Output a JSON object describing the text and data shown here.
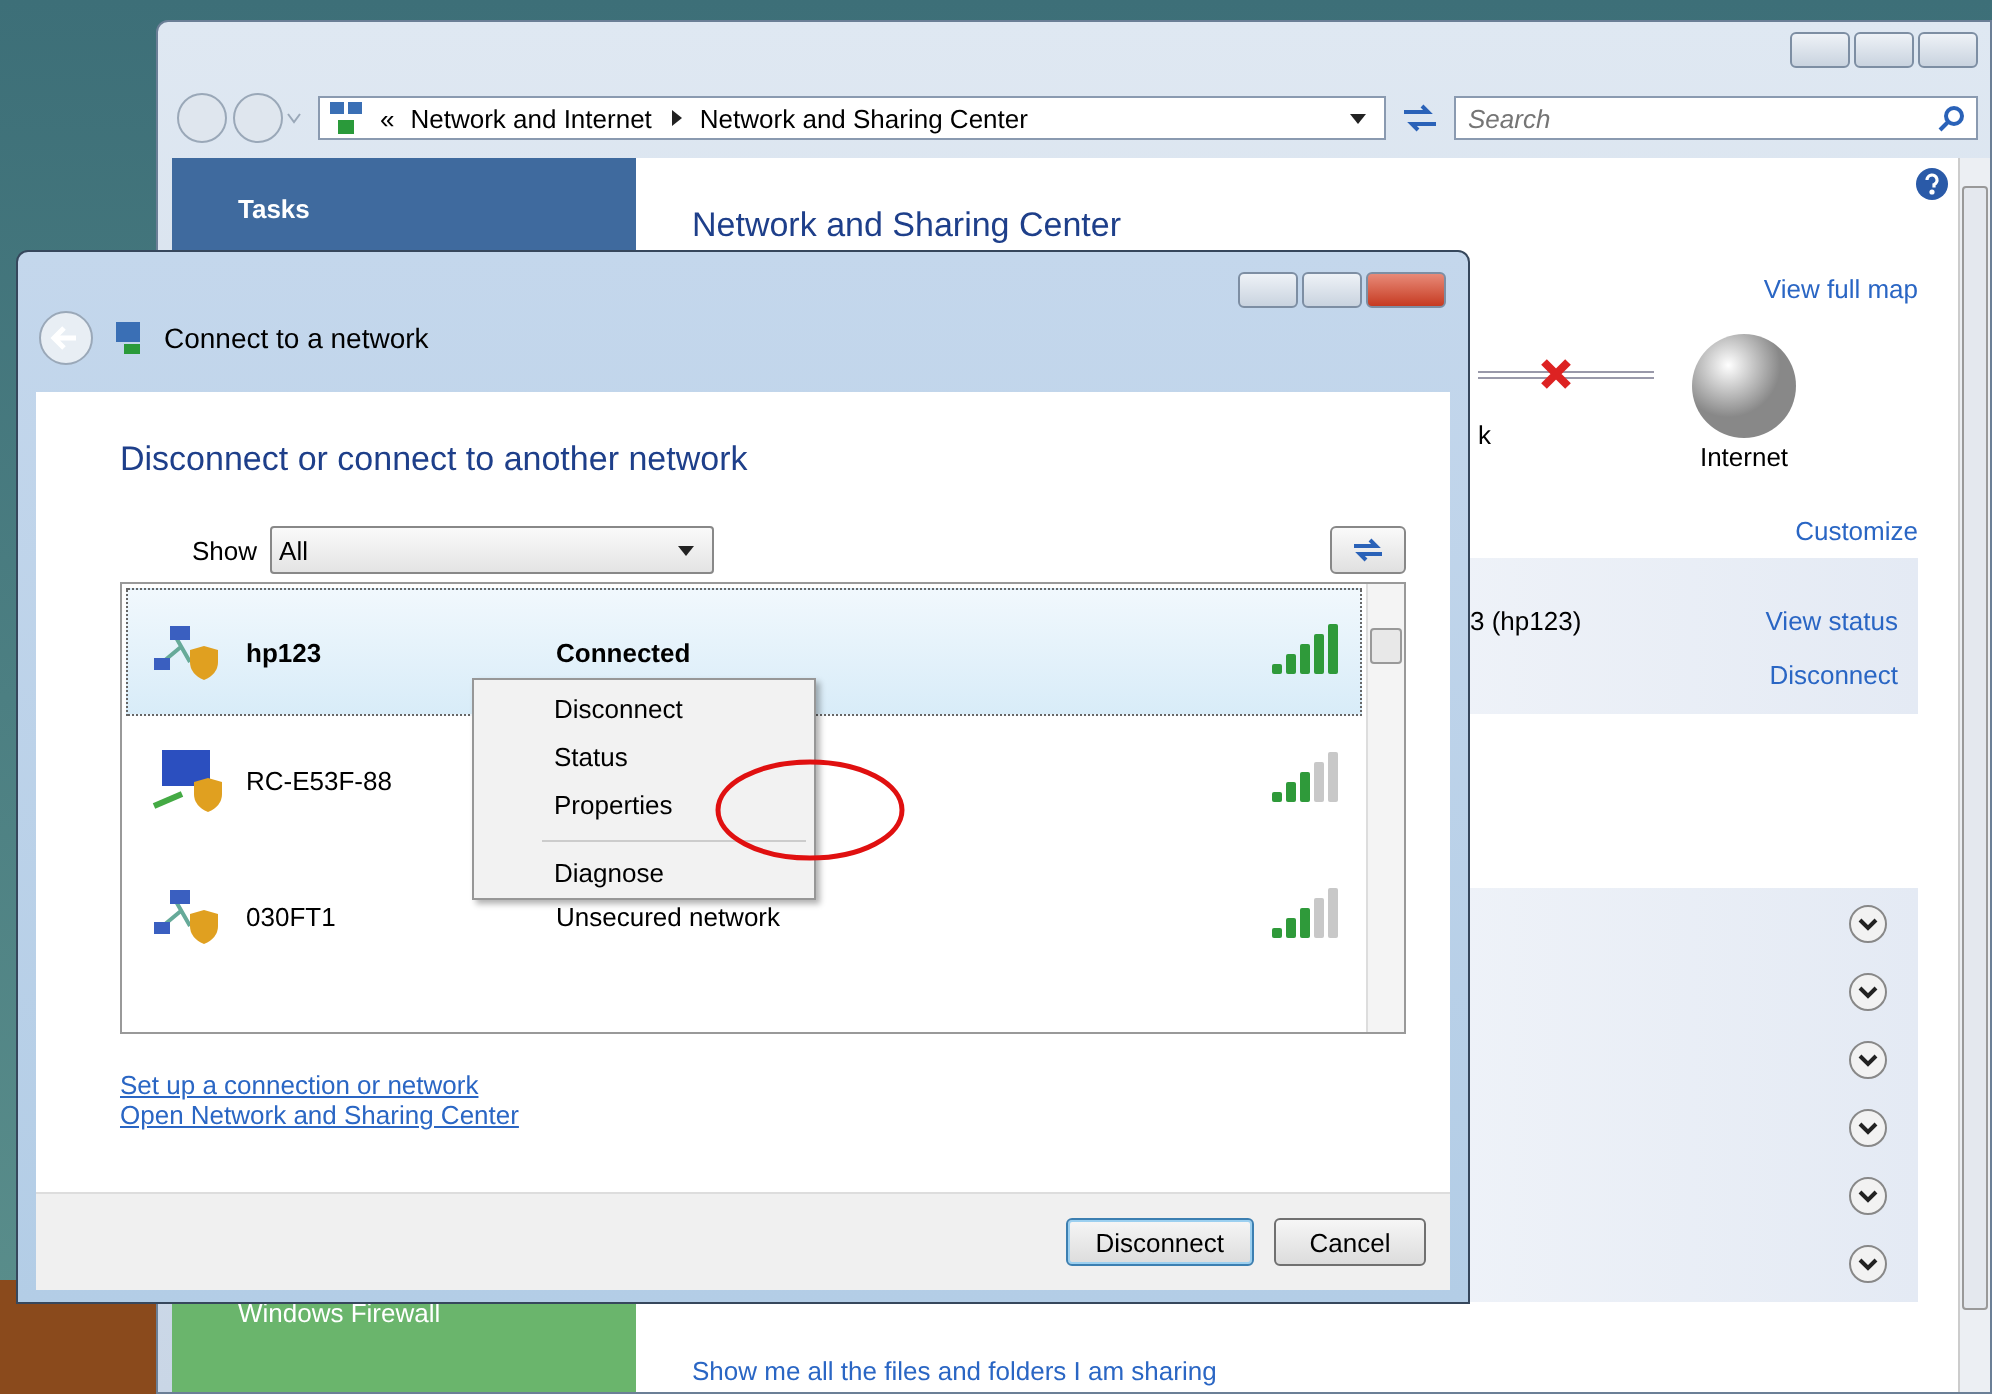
{
  "background_window": {
    "address_bar": {
      "overflow": "«",
      "breadcrumbs": [
        "Network and Internet",
        "Network and Sharing Center"
      ]
    },
    "search": {
      "placeholder": "Search"
    },
    "sidebar": {
      "heading": "Tasks",
      "bottom_item": "Windows Firewall"
    },
    "title": "Network and Sharing Center",
    "view_full_map": "View full map",
    "map": {
      "left_label": "k",
      "internet_label": "Internet"
    },
    "customize": "Customize",
    "connection": {
      "name": "3 (hp123)",
      "links": [
        "View status",
        "Disconnect"
      ]
    },
    "sections": [
      {
        "expanded": false
      },
      {
        "expanded": false
      },
      {
        "expanded": false
      },
      {
        "expanded": false
      },
      {
        "expanded": false
      },
      {
        "expanded": false
      }
    ],
    "sharing_link": "Show me all the files and folders I am sharing"
  },
  "dialog": {
    "title": "Connect to a network",
    "heading": "Disconnect or connect to another network",
    "show_label": "Show",
    "show_value": "All",
    "networks": [
      {
        "name": "hp123",
        "status": "Connected",
        "connected": true,
        "selected": true,
        "kind": "network",
        "strong_signal": true
      },
      {
        "name": "RC-E53F-88",
        "connected": false,
        "selected": false,
        "kind": "computer",
        "strong_signal": false
      },
      {
        "name": "030FT1",
        "status": "Unsecured network",
        "connected": false,
        "selected": false,
        "kind": "network",
        "strong_signal": false
      }
    ],
    "context_menu": [
      {
        "kind": "item",
        "label": "Disconnect"
      },
      {
        "kind": "item",
        "label": "Status"
      },
      {
        "kind": "item",
        "label": "Properties"
      },
      {
        "kind": "separator"
      },
      {
        "kind": "item",
        "label": "Diagnose"
      }
    ],
    "links": [
      "Set up a connection or network",
      "Open Network and Sharing Center"
    ],
    "buttons": [
      {
        "label": "Disconnect",
        "default": true
      },
      {
        "label": "Cancel",
        "default": false
      }
    ]
  }
}
